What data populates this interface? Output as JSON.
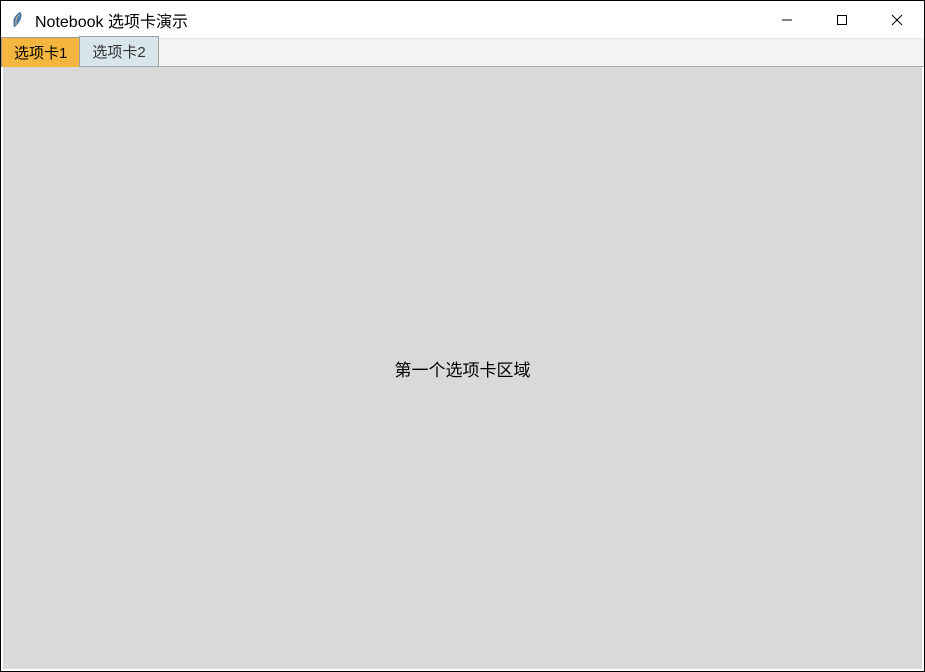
{
  "window": {
    "title": "Notebook 选项卡演示"
  },
  "tabs": [
    {
      "label": "选项卡1",
      "active": true
    },
    {
      "label": "选项卡2",
      "active": false
    }
  ],
  "content": {
    "label": "第一个选项卡区域"
  }
}
